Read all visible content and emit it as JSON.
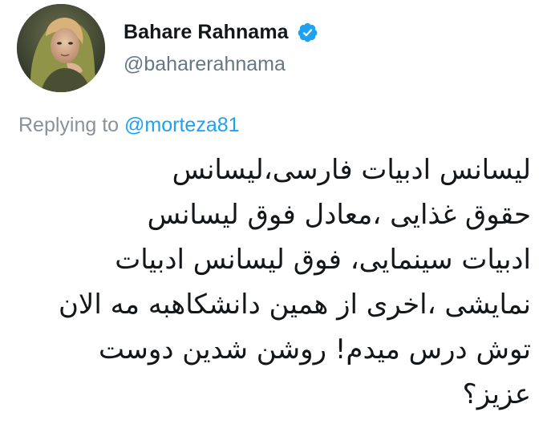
{
  "user": {
    "display_name": "Bahare Rahnama",
    "handle": "@baharerahnama",
    "verified": true,
    "avatar_icon": "profile-photo"
  },
  "reply": {
    "prefix": "Replying to",
    "mention": "@morteza81"
  },
  "tweet": {
    "lines": [
      "لیسانس ادبیات فارسی،لیسانس",
      "حقوق غذایی ،معادل فوق لیسانس",
      "ادبیات سینمایی، فوق لیسانس ادبیات",
      "نمایشی ،اخری از همین دانشکاهبه مه الان",
      "توش درس میدم! روشن شدین دوست",
      "عزیز؟"
    ]
  },
  "colors": {
    "text_primary": "#14171a",
    "text_secondary": "#657786",
    "accent_blue": "#1da1f2",
    "verified_blue": "#1da1f2"
  }
}
